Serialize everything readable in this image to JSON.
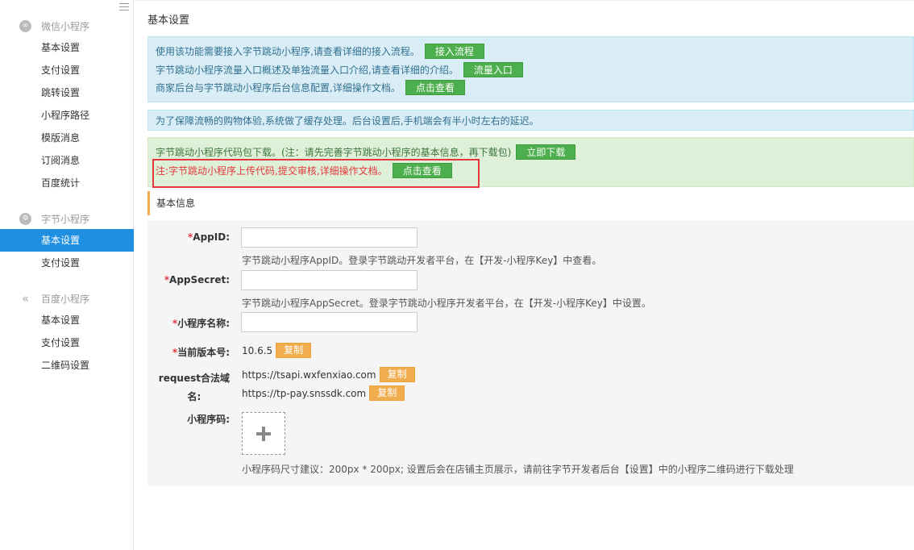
{
  "sidebar": {
    "groups": [
      {
        "title": "微信小程序",
        "icon": "link-icon",
        "items": [
          "基本设置",
          "支付设置",
          "跳转设置",
          "小程序路径",
          "模版消息",
          "订阅消息",
          "百度统计"
        ]
      },
      {
        "title": "字节小程序",
        "icon": "gear-icon",
        "items": [
          "基本设置",
          "支付设置"
        ]
      },
      {
        "title": "百度小程序",
        "icon": "double-chevron-left-icon",
        "items": [
          "基本设置",
          "支付设置",
          "二维码设置"
        ]
      }
    ],
    "active_item": "字节小程序 > 基本设置"
  },
  "page": {
    "title": "基本设置"
  },
  "info_alert": {
    "lines": [
      {
        "text": "使用该功能需要接入字节跳动小程序,请查看详细的接入流程。",
        "button": "接入流程"
      },
      {
        "text": "字节跳动小程序流量入口概述及单独流量入口介绍,请查看详细的介绍。",
        "button": "流量入口"
      },
      {
        "text": "商家后台与字节跳动小程序后台信息配置,详细操作文档。",
        "button": "点击查看"
      }
    ]
  },
  "cache_alert": {
    "text": "为了保障流畅的购物体验,系统做了缓存处理。后台设置后,手机端会有半小时左右的延迟。"
  },
  "download_alert": {
    "line1": {
      "text": "字节跳动小程序代码包下载。(注：请先完善字节跳动小程序的基本信息，再下载包)",
      "button": "立即下载"
    },
    "line2": {
      "text": "注:字节跳动小程序上传代码,提交审核,详细操作文档。",
      "button": "点击查看"
    }
  },
  "section": {
    "title": "基本信息"
  },
  "form": {
    "appid": {
      "label": "AppID:",
      "value": "",
      "help": "字节跳动小程序AppID。登录字节跳动开发者平台，在【开发-小程序Key】中查看。"
    },
    "appsecret": {
      "label": "AppSecret:",
      "value": "",
      "help": "字节跳动小程序AppSecret。登录字节跳动小程序开发者平台，在【开发-小程序Key】中设置。"
    },
    "name": {
      "label": "小程序名称:",
      "value": ""
    },
    "version": {
      "label": "当前版本号:",
      "value": "10.6.5",
      "button": "复制"
    },
    "request_domain": {
      "label_line1": "request合法域",
      "label_line2": "名:",
      "values": [
        {
          "url": "https://tsapi.wxfenxiao.com",
          "button": "复制"
        },
        {
          "url": "https://tp-pay.snssdk.com",
          "button": "复制"
        }
      ]
    },
    "qrcode": {
      "label": "小程序码:",
      "help": "小程序码尺寸建议：200px * 200px; 设置后会在店铺主页展示，请前往字节开发者后台【设置】中的小程序二维码进行下载处理"
    },
    "required_mark": "*"
  }
}
